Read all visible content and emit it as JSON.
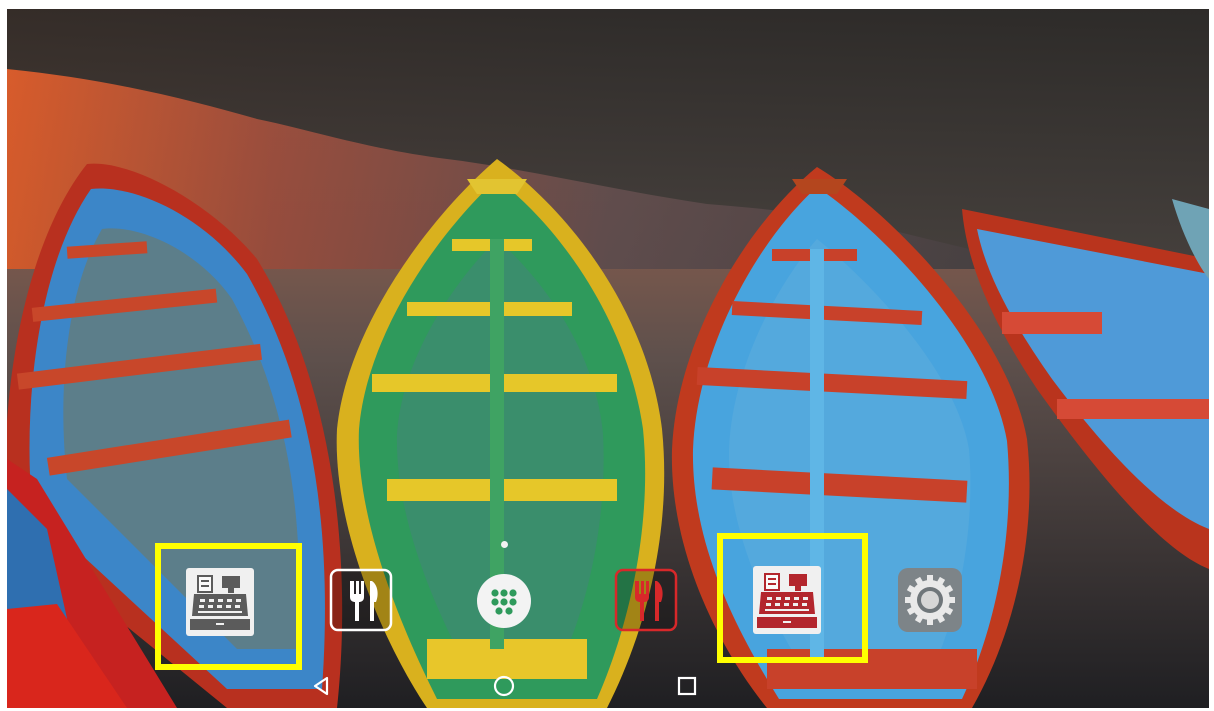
{
  "home": {
    "page_indicator": {
      "current": 1,
      "total": 1
    }
  },
  "dock": {
    "apps": [
      {
        "name": "cash-register-app",
        "icon": "cash-register-icon",
        "highlighted": true
      },
      {
        "name": "restaurant-app",
        "icon": "fork-knife-icon",
        "highlighted": false
      },
      {
        "name": "app-drawer",
        "icon": "app-drawer-icon",
        "highlighted": false
      },
      {
        "name": "restaurant-red-app",
        "icon": "fork-knife-red-icon",
        "highlighted": false
      },
      {
        "name": "cash-register-red-app",
        "icon": "cash-register-red-icon",
        "highlighted": true
      },
      {
        "name": "settings-app",
        "icon": "gear-icon",
        "highlighted": false
      }
    ]
  },
  "navigation": {
    "buttons": [
      "back",
      "home",
      "recents"
    ]
  },
  "colors": {
    "highlight": "#ffff00",
    "nav_icon": "#ffffff",
    "register_gray": "#5b5b5b",
    "register_red": "#b3262d"
  }
}
